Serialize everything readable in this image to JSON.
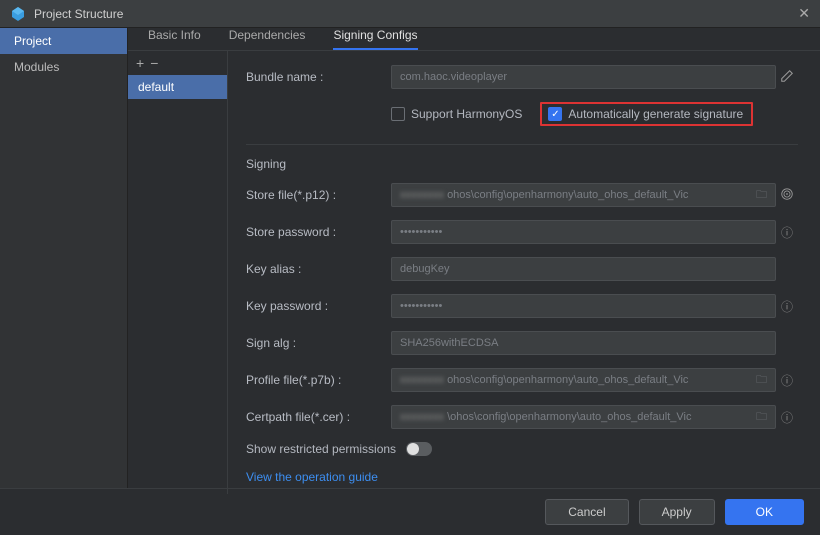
{
  "window": {
    "title": "Project Structure"
  },
  "sidebar": {
    "items": [
      {
        "label": "Project",
        "selected": true
      },
      {
        "label": "Modules",
        "selected": false
      }
    ]
  },
  "tabs": [
    {
      "label": "Basic Info",
      "active": false
    },
    {
      "label": "Dependencies",
      "active": false
    },
    {
      "label": "Signing Configs",
      "active": true
    }
  ],
  "configs_list": {
    "add_label": "+",
    "remove_label": "−",
    "items": [
      {
        "label": "default",
        "selected": true
      }
    ]
  },
  "form": {
    "bundle_name_label": "Bundle name :",
    "bundle_name_value": "com.haoc.videoplayer",
    "support_harmonyos_label": "Support HarmonyOS",
    "support_harmonyos_checked": false,
    "auto_gen_label": "Automatically generate signature",
    "auto_gen_checked": true,
    "signing_section_title": "Signing",
    "store_file_label": "Store file(*.p12) :",
    "store_file_value": "ohos\\config\\openharmony\\auto_ohos_default_Vic",
    "store_password_label": "Store password :",
    "store_password_value": "•••••••••••",
    "key_alias_label": "Key alias :",
    "key_alias_value": "debugKey",
    "key_password_label": "Key password :",
    "key_password_value": "•••••••••••",
    "sign_alg_label": "Sign alg :",
    "sign_alg_value": "SHA256withECDSA",
    "profile_file_label": "Profile file(*.p7b) :",
    "profile_file_value": "ohos\\config\\openharmony\\auto_ohos_default_Vic",
    "certpath_file_label": "Certpath file(*.cer) :",
    "certpath_file_value": "\\ohos\\config\\openharmony\\auto_ohos_default_Vic",
    "show_restricted_label": "Show restricted permissions",
    "show_restricted_on": false,
    "guide_link": "View the operation guide"
  },
  "footer": {
    "cancel": "Cancel",
    "apply": "Apply",
    "ok": "OK"
  }
}
